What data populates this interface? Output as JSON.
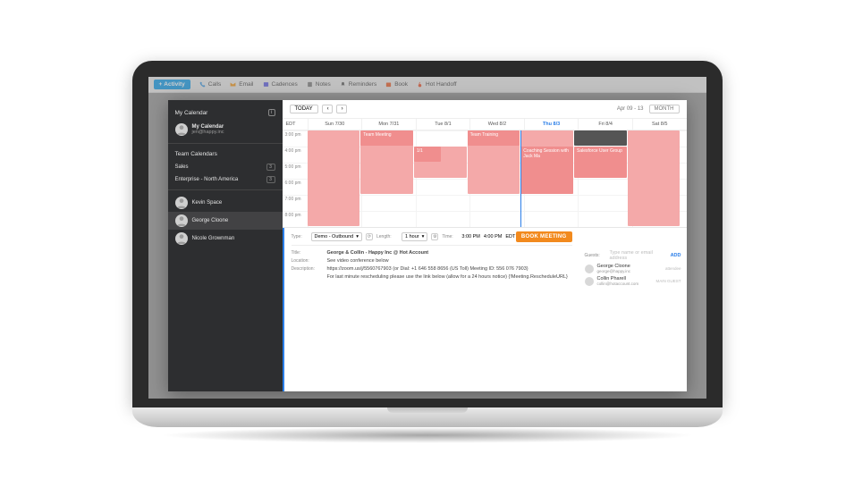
{
  "toolbar": {
    "activity": "Activity",
    "items": [
      {
        "label": "Calls"
      },
      {
        "label": "Email"
      },
      {
        "label": "Cadences"
      },
      {
        "label": "Notes"
      },
      {
        "label": "Reminders"
      },
      {
        "label": "Book"
      },
      {
        "label": "Hot Handoff"
      }
    ]
  },
  "sidebar": {
    "my_calendar_title": "My Calendar",
    "me": {
      "name": "My Calendar",
      "sub": "jen@happy.inc"
    },
    "team_title": "Team Calendars",
    "teams": [
      {
        "label": "Sales",
        "badge": "3"
      },
      {
        "label": "Enterprise - North America",
        "badge": "3"
      }
    ],
    "people": [
      {
        "name": "Kevin Space"
      },
      {
        "name": "George Cloone"
      },
      {
        "name": "Nicole Grownman"
      }
    ]
  },
  "calendar": {
    "today_btn": "TODAY",
    "range": "Apr 09 - 13",
    "view_btn": "MONTH",
    "tz": "EDT",
    "days": [
      "Sun 7/30",
      "Mon 7/31",
      "Tue 8/1",
      "Wed 8/2",
      "Thu 8/3",
      "Fri 8/4",
      "Sat 8/5"
    ],
    "today_index": 4,
    "times": [
      "3:00 pm",
      "4:00 pm",
      "5:00 pm",
      "6:00 pm",
      "7:00 pm",
      "8:00 pm"
    ],
    "events": {
      "team_meeting": "Team Meeting",
      "one_one": "1/1",
      "team_training": "Team Training",
      "coaching": "Coaching Session with Jack Ma",
      "sf_user_group": "Salesforce User Group"
    }
  },
  "form": {
    "type_lbl": "Type:",
    "type_val": "Demo - Outbound",
    "length_lbl": "Length:",
    "length_val": "1 hour",
    "time_lbl": "Time:",
    "time_start": "3:00 PM",
    "time_end": "4:00 PM",
    "time_tz": "EDT",
    "book_btn": "BOOK MEETING",
    "title_lbl": "Title:",
    "title_val": "George & Collin - Happy Inc @ Hot Account",
    "location_lbl": "Location:",
    "location_val": "See video conference below",
    "desc_lbl": "Description:",
    "desc_line1": "https://zoom.us/j/5560767903  (or Dial: +1 646 558 8656 (US Toll) Meeting ID: 556 076 7903)",
    "desc_line2": "For last minute rescheduling please use the link below (allow for a 24 hours notice) {!Meeting.RescheduleURL}",
    "guests_lbl": "Guests:",
    "guests_placeholder": "Type name or email address",
    "add_lbl": "ADD",
    "guests": [
      {
        "name": "George Cloone",
        "email": "george@happy.inc",
        "tag": "attendee"
      },
      {
        "name": "Collin Pharell",
        "email": "collin@hotaccount.com",
        "tag": "MAIN GUEST"
      }
    ]
  }
}
